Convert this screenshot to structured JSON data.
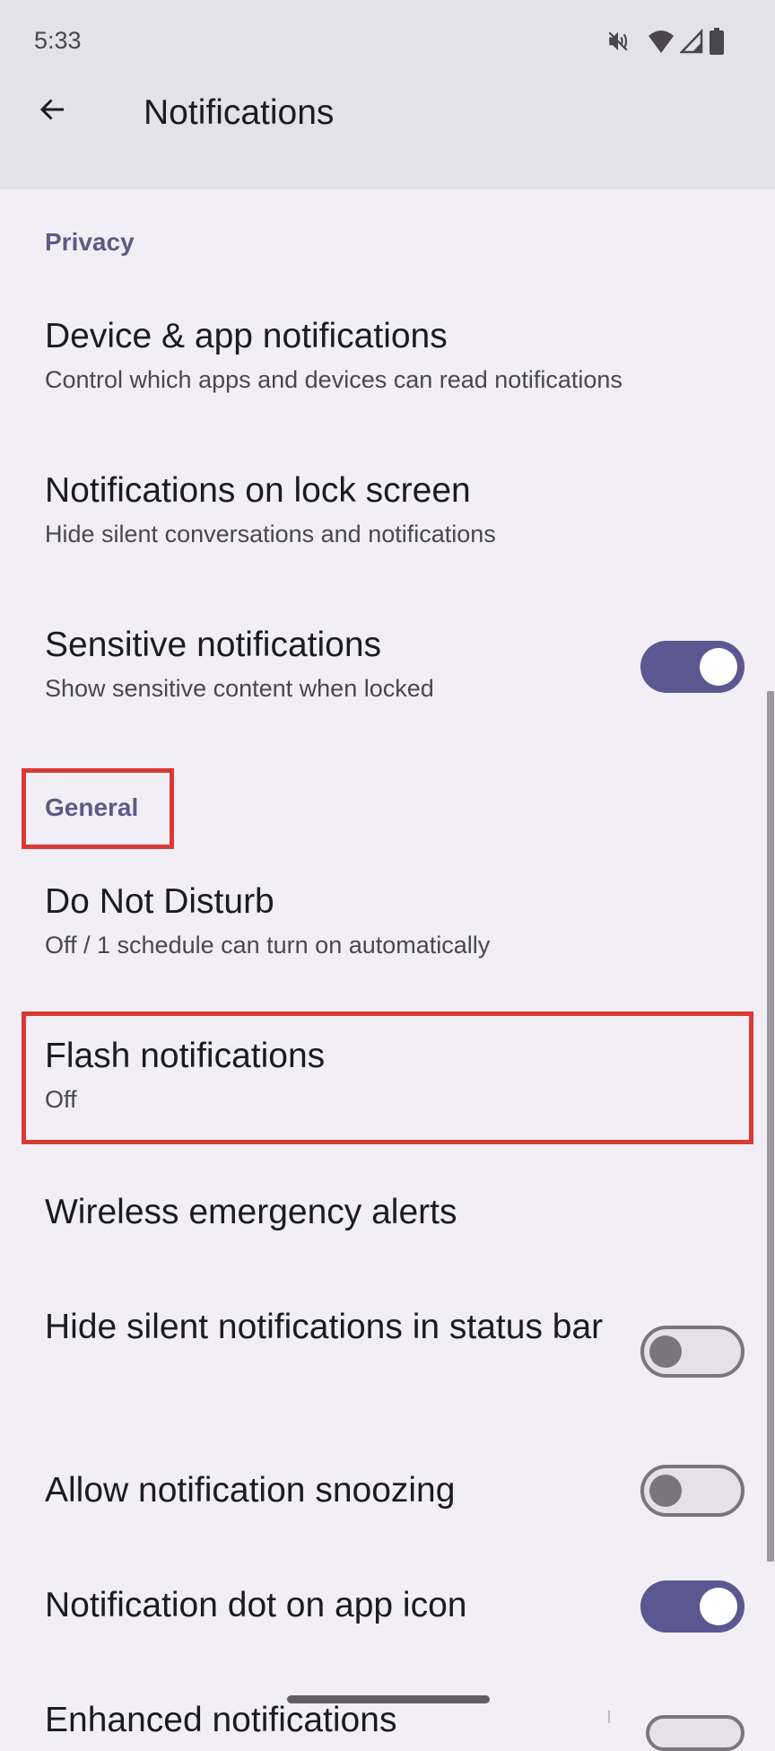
{
  "status_bar": {
    "time": "5:33",
    "icons": [
      "vibrate-off-icon",
      "wifi-icon",
      "cell-signal-icon",
      "battery-icon"
    ]
  },
  "app_bar": {
    "back_icon": "arrow-back-icon",
    "title": "Notifications"
  },
  "sections": [
    {
      "header": "Privacy",
      "items": [
        {
          "title": "Device & app notifications",
          "summary": "Control which apps and devices can read notifications"
        },
        {
          "title": "Notifications on lock screen",
          "summary": "Hide silent conversations and notifications"
        },
        {
          "title": "Sensitive notifications",
          "summary": "Show sensitive content when locked",
          "toggle": true
        }
      ]
    },
    {
      "header": "General",
      "items": [
        {
          "title": "Do Not Disturb",
          "summary": "Off / 1 schedule can turn on automatically"
        },
        {
          "title": "Flash notifications",
          "summary": "Off"
        },
        {
          "title": "Wireless emergency alerts"
        },
        {
          "title": "Hide silent notifications in status bar",
          "toggle": false
        },
        {
          "title": "Allow notification snoozing",
          "toggle": false
        },
        {
          "title": "Notification dot on app icon",
          "toggle": true
        },
        {
          "title": "Enhanced notifications"
        }
      ]
    }
  ],
  "colors": {
    "accent": "#5b5791",
    "section_header": "#5e5a85",
    "highlight_annotation": "#d93a35",
    "background": "#f1eff5",
    "app_bar": "#e4e2e9"
  }
}
